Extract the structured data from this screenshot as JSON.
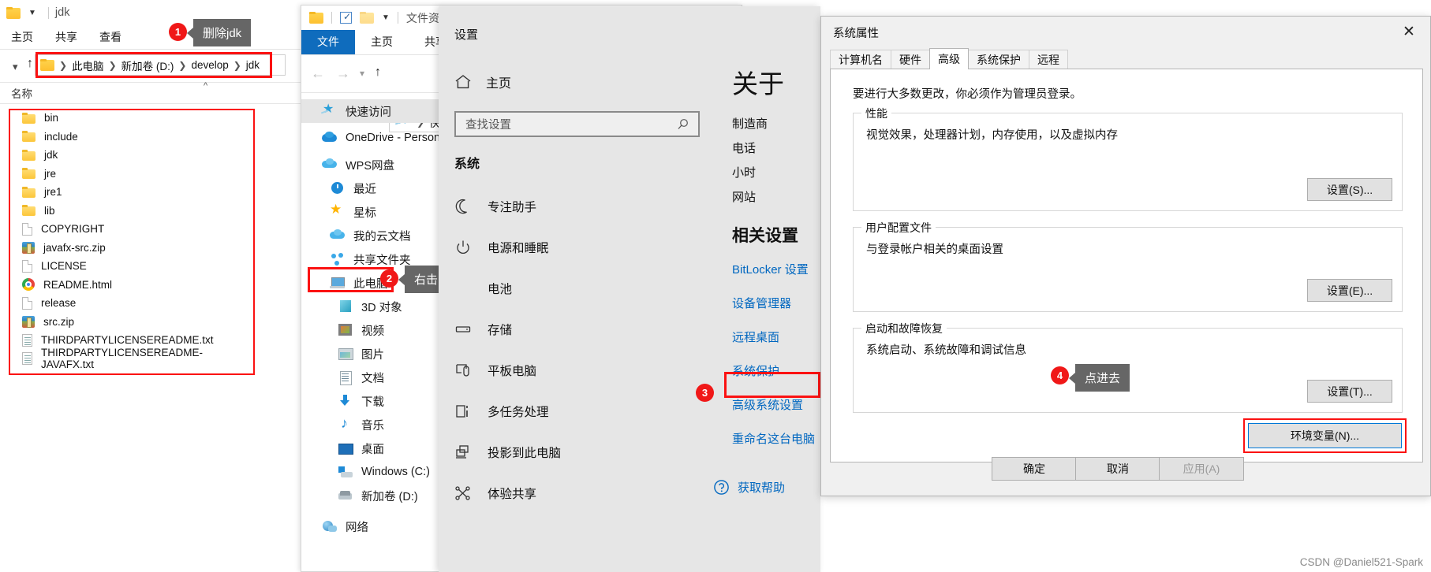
{
  "explorer_left": {
    "title": "jdk",
    "ribbon_tabs": [
      "主页",
      "共享",
      "查看"
    ],
    "address": {
      "crumbs": [
        "此电脑",
        "新加卷 (D:)",
        "develop",
        "jdk"
      ]
    },
    "column_header": "名称",
    "files": [
      {
        "name": "bin",
        "icon": "folder-icon"
      },
      {
        "name": "include",
        "icon": "folder-icon"
      },
      {
        "name": "jdk",
        "icon": "folder-icon"
      },
      {
        "name": "jre",
        "icon": "folder-icon"
      },
      {
        "name": "jre1",
        "icon": "folder-icon"
      },
      {
        "name": "lib",
        "icon": "folder-icon"
      },
      {
        "name": "COPYRIGHT",
        "icon": "document-icon"
      },
      {
        "name": "javafx-src.zip",
        "icon": "zip-archive-icon"
      },
      {
        "name": "LICENSE",
        "icon": "document-icon"
      },
      {
        "name": "README.html",
        "icon": "chrome-browser-icon"
      },
      {
        "name": "release",
        "icon": "document-icon"
      },
      {
        "name": "src.zip",
        "icon": "zip-archive-icon"
      },
      {
        "name": "THIRDPARTYLICENSEREADME.txt",
        "icon": "text-file-icon"
      },
      {
        "name": "THIRDPARTYLICENSEREADME-JAVAFX.txt",
        "icon": "text-file-icon"
      }
    ]
  },
  "explorer_mid": {
    "title": "文件资源管理",
    "tabs": [
      "文件",
      "主页",
      "共享"
    ],
    "address_value": "快速",
    "nav_items": [
      {
        "label": "快速访问",
        "icon": "quick-access-star-icon",
        "highlight": true
      },
      {
        "label": "OneDrive - Personal",
        "icon": "onedrive-cloud-icon",
        "highlight": false
      },
      {
        "label": "WPS网盘",
        "icon": "wps-cloud-icon",
        "highlight": false
      },
      {
        "label": "最近",
        "icon": "recent-clock-icon",
        "highlight": false
      },
      {
        "label": "星标",
        "icon": "starred-star-icon",
        "highlight": false
      },
      {
        "label": "我的云文档",
        "icon": "my-cloud-docs-icon",
        "highlight": false
      },
      {
        "label": "共享文件夹",
        "icon": "shared-folder-icon",
        "highlight": false
      },
      {
        "label": "此电脑",
        "icon": "this-pc-icon",
        "highlight": false
      },
      {
        "label": "3D 对象",
        "icon": "3d-objects-icon",
        "highlight": false
      },
      {
        "label": "视频",
        "icon": "videos-icon",
        "highlight": false
      },
      {
        "label": "图片",
        "icon": "pictures-icon",
        "highlight": false
      },
      {
        "label": "文档",
        "icon": "documents-icon",
        "highlight": false
      },
      {
        "label": "下载",
        "icon": "downloads-icon",
        "highlight": false
      },
      {
        "label": "音乐",
        "icon": "music-icon",
        "highlight": false
      },
      {
        "label": "桌面",
        "icon": "desktop-icon",
        "highlight": false
      },
      {
        "label": "Windows (C:)",
        "icon": "windows-drive-icon",
        "highlight": false
      },
      {
        "label": "新加卷 (D:)",
        "icon": "local-drive-icon",
        "highlight": false
      },
      {
        "label": "网络",
        "icon": "network-icon",
        "highlight": false
      }
    ]
  },
  "settings": {
    "window_title": "设置",
    "home_label": "主页",
    "search_placeholder": "查找设置",
    "section_header": "系统",
    "items": [
      {
        "label": "专注助手",
        "icon": "moon-icon"
      },
      {
        "label": "电源和睡眠",
        "icon": "power-icon"
      },
      {
        "label": "电池",
        "icon": "battery-icon"
      },
      {
        "label": "存储",
        "icon": "storage-icon"
      },
      {
        "label": "平板电脑",
        "icon": "tablet-icon"
      },
      {
        "label": "多任务处理",
        "icon": "multitasking-icon"
      },
      {
        "label": "投影到此电脑",
        "icon": "project-to-pc-icon"
      },
      {
        "label": "体验共享",
        "icon": "shared-experiences-icon"
      }
    ],
    "about": {
      "title": "关于",
      "fields": [
        "制造商",
        "电话",
        "小时",
        "网站"
      ],
      "related_title": "相关设置",
      "related_links": [
        "BitLocker 设置",
        "设备管理器",
        "远程桌面",
        "系统保护",
        "高级系统设置",
        "重命名这台电脑"
      ],
      "help_label": "获取帮助"
    }
  },
  "system_properties": {
    "title": "系统属性",
    "close_glyph": "✕",
    "tabs": [
      "计算机名",
      "硬件",
      "高级",
      "系统保护",
      "远程"
    ],
    "active_tab": "高级",
    "note": "要进行大多数更改，你必须作为管理员登录。",
    "groups": [
      {
        "legend": "性能",
        "text": "视觉效果，处理器计划，内存使用，以及虚拟内存",
        "button": "设置(S)..."
      },
      {
        "legend": "用户配置文件",
        "text": "与登录帐户相关的桌面设置",
        "button": "设置(E)..."
      },
      {
        "legend": "启动和故障恢复",
        "text": "系统启动、系统故障和调试信息",
        "button": "设置(T)..."
      }
    ],
    "env_button": "环境变量(N)...",
    "footer_buttons": [
      "确定",
      "取消",
      "应用(A)"
    ]
  },
  "callouts": [
    {
      "number": "1",
      "text": "删除jdk"
    },
    {
      "number": "2",
      "text": "右击 “属性”"
    },
    {
      "number": "3",
      "text": ""
    },
    {
      "number": "4",
      "text": "点进去"
    }
  ],
  "watermark": "CSDN @Daniel521-Spark",
  "colors": {
    "accent_red": "#fb1212",
    "badge_red": "#f01818",
    "tooltip_gray": "#666666",
    "link_blue": "#0067c0",
    "ribbon_blue": "#0f6cbd"
  }
}
